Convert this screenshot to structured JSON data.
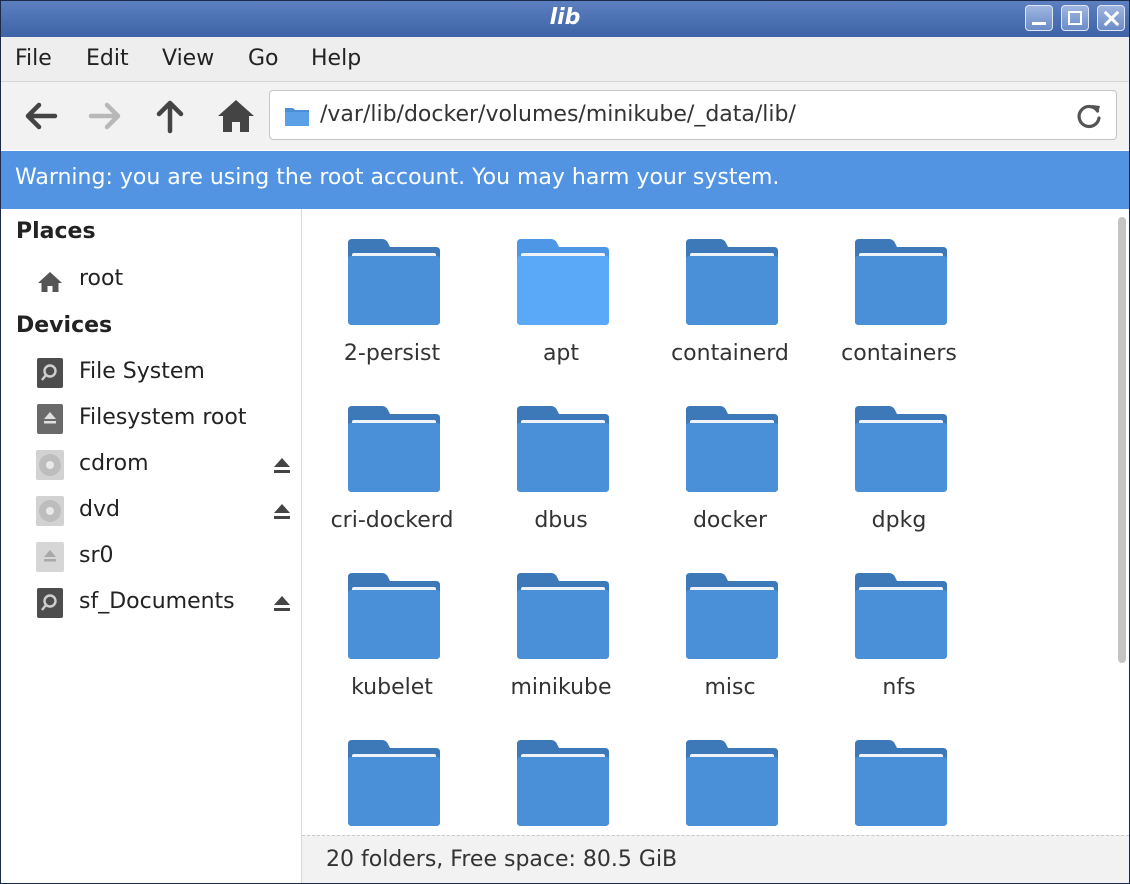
{
  "window": {
    "title": "lib"
  },
  "menu": [
    "File",
    "Edit",
    "View",
    "Go",
    "Help"
  ],
  "toolbar": {
    "path": "/var/lib/docker/volumes/minikube/_data/lib/",
    "icons": [
      "back-icon",
      "forward-icon",
      "up-icon",
      "home-icon",
      "folder-icon",
      "reload-icon"
    ]
  },
  "warning": {
    "text": "Warning: you are using the root account. You may harm your system."
  },
  "sidebar": {
    "places_title": "Places",
    "places": [
      {
        "label": "root",
        "icon": "home-icon"
      }
    ],
    "devices_title": "Devices",
    "devices": [
      {
        "label": "File System",
        "icon": "drive-icon",
        "eject": false
      },
      {
        "label": "Filesystem root",
        "icon": "drive-eject-icon",
        "eject": false
      },
      {
        "label": "cdrom",
        "icon": "disc-icon",
        "eject": true
      },
      {
        "label": "dvd",
        "icon": "disc-icon",
        "eject": true
      },
      {
        "label": "sr0",
        "icon": "optical-eject-icon",
        "eject": false
      },
      {
        "label": "sf_Documents",
        "icon": "drive-icon",
        "eject": true
      }
    ]
  },
  "folders": [
    {
      "name": "2-persist",
      "selected": false
    },
    {
      "name": "apt",
      "selected": true
    },
    {
      "name": "containerd",
      "selected": false
    },
    {
      "name": "containers",
      "selected": false
    },
    {
      "name": "cri-dockerd",
      "selected": false
    },
    {
      "name": "dbus",
      "selected": false
    },
    {
      "name": "docker",
      "selected": false
    },
    {
      "name": "dpkg",
      "selected": false
    },
    {
      "name": "kubelet",
      "selected": false
    },
    {
      "name": "minikube",
      "selected": false
    },
    {
      "name": "misc",
      "selected": false
    },
    {
      "name": "nfs",
      "selected": false
    },
    {
      "name": "",
      "selected": false
    },
    {
      "name": "",
      "selected": false
    },
    {
      "name": "",
      "selected": false
    },
    {
      "name": "",
      "selected": false
    }
  ],
  "status": {
    "text": "20 folders, Free space: 80.5  GiB"
  },
  "colors": {
    "accent": "#5294e2",
    "folder": "#4a90d9",
    "folder_dark": "#3d79b8",
    "folder_selected": "#5aa8f8"
  }
}
